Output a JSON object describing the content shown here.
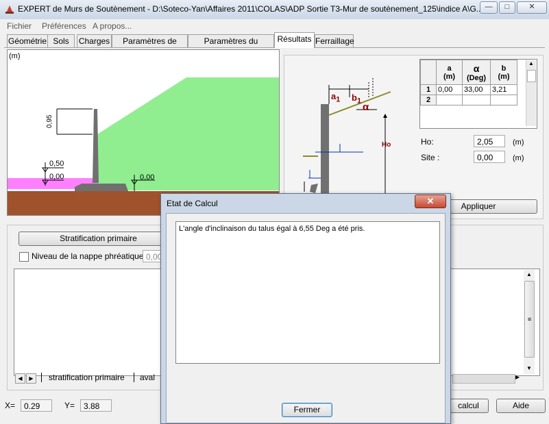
{
  "window": {
    "title": "EXPERT de Murs de Soutènement - D:\\Soteco-Yan\\Affaires 2011\\COLAS\\ADP Sortie T3-Mur de soutènement_125\\indice A\\G...",
    "btn_min": "—",
    "btn_max": "□",
    "btn_close": "✕"
  },
  "menu": [
    "Fichier",
    "Préférences",
    "A propos..."
  ],
  "tabs": [
    "Géométrie",
    "Sols",
    "Charges",
    "Paramètres de calcul",
    "Paramètres du ferraillage",
    "Résultats",
    "Ferraillage"
  ],
  "diagram": {
    "unit": "(m)",
    "dim_095": "0,95",
    "level_050": "0,50",
    "level_000a": "0,00",
    "level_000b": "0,00",
    "colors": {
      "fill_soil": "#90ee90",
      "water": "#ff80ff",
      "base": "#a0522d",
      "wall": "#707070"
    }
  },
  "sketch": {
    "a1": "a",
    "a1_sub": "1",
    "b1": "b",
    "b1_sub": "1",
    "alpha": "α",
    "ho": "Ho"
  },
  "grid": {
    "headers": [
      {
        "top": "a",
        "bottom": "(m)"
      },
      {
        "top": "α",
        "bottom": "(Deg)"
      },
      {
        "top": "b",
        "bottom": "(m)"
      }
    ],
    "rows": [
      {
        "n": "1",
        "a": "0,00",
        "alpha": "33,00",
        "b": "3,21"
      },
      {
        "n": "2",
        "a": "",
        "alpha": "",
        "b": ""
      }
    ]
  },
  "ho_label": "Ho:",
  "ho_value": "2,05",
  "ho_unit": "(m)",
  "site_label": "Site :",
  "site_value": "0,00",
  "site_unit": "(m)",
  "appliquer": "Appliquer",
  "strat_button": "Stratification primaire",
  "nappe_label": "Niveau de la nappe phréatique :",
  "nappe_value": "0,00",
  "sheet_tabs": [
    "stratification primaire",
    "aval"
  ],
  "status": {
    "x_label": "X=",
    "x_value": "0.29",
    "y_label": "Y=",
    "y_value": "3.88",
    "calcul": "calcul",
    "aide": "Aide"
  },
  "dialog": {
    "title": "Etat de Calcul",
    "message": "L'angle d'inclinaison du talus égal à 6,55 Deg a été pris.",
    "close": "Fermer"
  }
}
